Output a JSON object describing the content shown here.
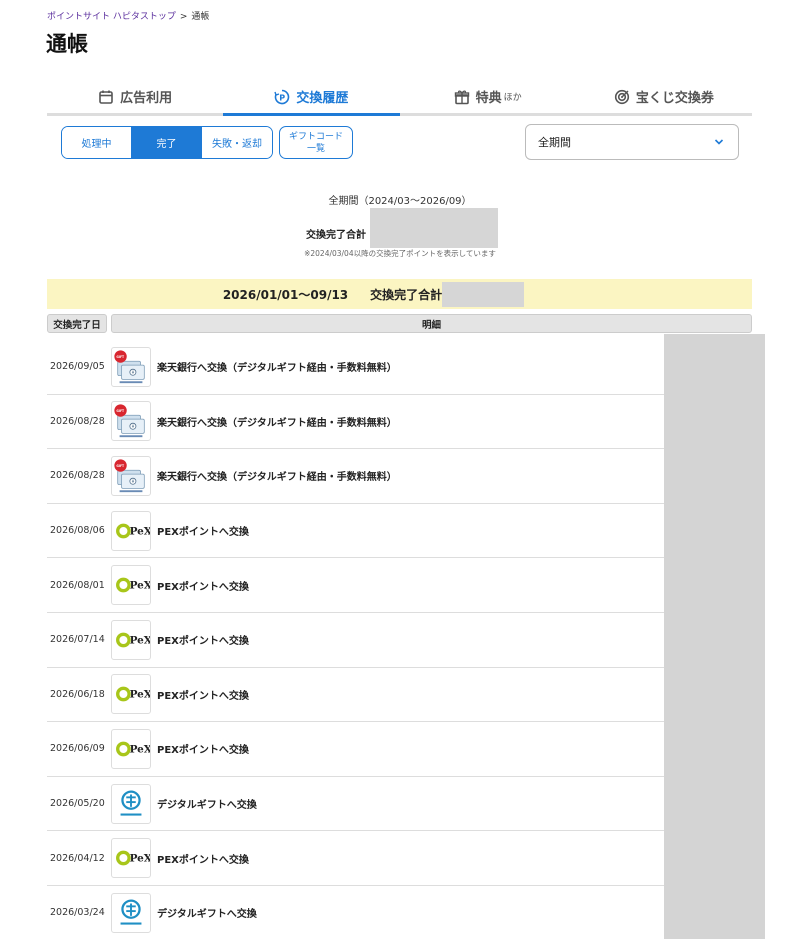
{
  "breadcrumb": {
    "home": "ポイントサイト ハピタストップ",
    "separator": ">",
    "current": "通帳"
  },
  "page_title": "通帳",
  "tabs": [
    {
      "label": "広告利用",
      "icon": "calendar-icon"
    },
    {
      "label": "交換履歴",
      "icon": "point-exchange-icon"
    },
    {
      "label": "特典",
      "suffix": "ほか",
      "icon": "gift-box-icon"
    },
    {
      "label": "宝くじ交換券",
      "icon": "target-icon"
    }
  ],
  "status_filter": [
    "処理中",
    "完了",
    "失敗・返却"
  ],
  "gift_code_button": [
    "ギフトコード",
    "一覧"
  ],
  "period_select": {
    "value": "全期間"
  },
  "summary": {
    "period": "全期間（2024/03〜2026/09）",
    "total_label": "交換完了合計",
    "note": "※2024/03/04以降の交換完了ポイントを表示しています"
  },
  "year_band": {
    "range": "2026/01/01〜09/13",
    "label": "交換完了合計"
  },
  "table": {
    "col_date": "交換完了日",
    "col_desc": "明細",
    "rows": [
      {
        "date": "2026/09/05",
        "logo": "rakuten-bank-icon",
        "desc": "楽天銀行へ交換（デジタルギフト経由・手数料無料）"
      },
      {
        "date": "2026/08/28",
        "logo": "rakuten-bank-icon",
        "desc": "楽天銀行へ交換（デジタルギフト経由・手数料無料）"
      },
      {
        "date": "2026/08/28",
        "logo": "rakuten-bank-icon",
        "desc": "楽天銀行へ交換（デジタルギフト経由・手数料無料）"
      },
      {
        "date": "2026/08/06",
        "logo": "pex-icon",
        "desc": "PEXポイントへ交換"
      },
      {
        "date": "2026/08/01",
        "logo": "pex-icon",
        "desc": "PEXポイントへ交換"
      },
      {
        "date": "2026/07/14",
        "logo": "pex-icon",
        "desc": "PEXポイントへ交換"
      },
      {
        "date": "2026/06/18",
        "logo": "pex-icon",
        "desc": "PEXポイントへ交換"
      },
      {
        "date": "2026/06/09",
        "logo": "pex-icon",
        "desc": "PEXポイントへ交換"
      },
      {
        "date": "2026/05/20",
        "logo": "digital-gift-icon",
        "desc": "デジタルギフトへ交換"
      },
      {
        "date": "2026/04/12",
        "logo": "pex-icon",
        "desc": "PEXポイントへ交換"
      },
      {
        "date": "2026/03/24",
        "logo": "digital-gift-icon",
        "desc": "デジタルギフトへ交換"
      }
    ]
  },
  "colors": {
    "accent": "#1e7ad6",
    "band": "#fbf5c2",
    "link": "#5b2f9e"
  }
}
